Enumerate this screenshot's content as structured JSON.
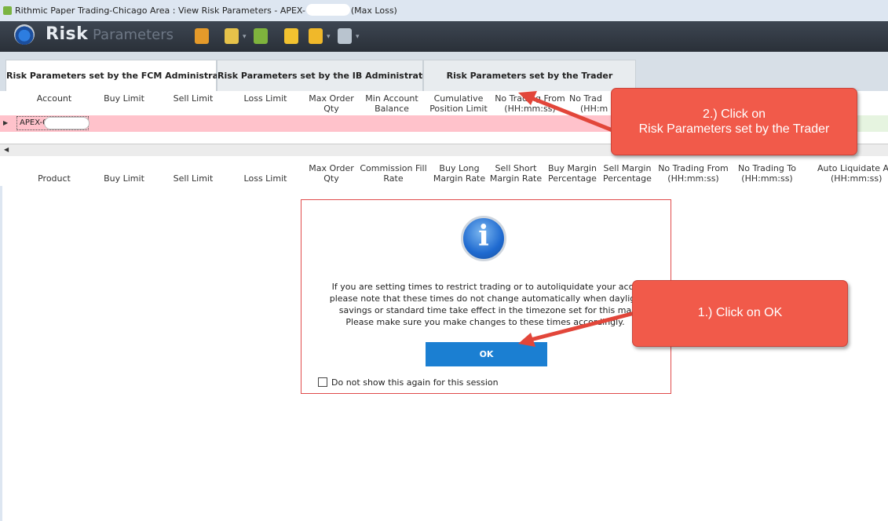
{
  "window": {
    "title_prefix": "Rithmic Paper Trading-Chicago Area : View Risk Parameters - APEX-",
    "title_suffix": "(Max Loss)"
  },
  "toolbar": {
    "logo_bold": "Risk",
    "logo_light": "Parameters"
  },
  "tabs": [
    {
      "label": "Risk Parameters set by the FCM Administrator",
      "active": true
    },
    {
      "label": "Risk Parameters set by the IB Administrator",
      "active": false
    },
    {
      "label": "Risk Parameters set by the Trader",
      "active": false
    }
  ],
  "account_grid": {
    "headers": [
      [
        "",
        "Account"
      ],
      [
        "",
        "Buy Limit"
      ],
      [
        "",
        "Sell Limit"
      ],
      [
        "",
        "Loss Limit"
      ],
      [
        "Max Order",
        "Qty"
      ],
      [
        "Min Account",
        "Balance"
      ],
      [
        "Cumulative",
        "Position Limit"
      ],
      [
        "No Trading From",
        "(HH:mm:ss)"
      ],
      [
        "No Trad",
        "(HH:m"
      ]
    ],
    "row_account": "APEX-00"
  },
  "product_grid": {
    "headers": [
      [
        "",
        "Product"
      ],
      [
        "",
        "Buy Limit"
      ],
      [
        "",
        "Sell Limit"
      ],
      [
        "",
        "Loss Limit"
      ],
      [
        "Max Order",
        "Qty"
      ],
      [
        "Commission Fill",
        "Rate"
      ],
      [
        "Buy Long",
        "Margin Rate"
      ],
      [
        "Sell Short",
        "Margin Rate"
      ],
      [
        "Buy Margin",
        "Percentage"
      ],
      [
        "Sell Margin",
        "Percentage"
      ],
      [
        "No Trading From",
        "(HH:mm:ss)"
      ],
      [
        "No Trading To",
        "(HH:mm:ss)"
      ],
      [
        "Auto Liquidate At",
        "(HH:mm:ss)"
      ]
    ]
  },
  "dialog": {
    "lines": [
      "If you are setting times to restrict trading or to autoliquidate your acco",
      "please note that these times do not change automatically when dayligh",
      "savings or standard time take effect in the timezone set for this ma",
      "Please make sure you make changes to these times accordingly."
    ],
    "ok_label": "OK",
    "checkbox_label": "Do not show this again for this session"
  },
  "callouts": {
    "tab_line1": "2.) Click on",
    "tab_line2": "Risk Parameters set by the Trader",
    "ok": "1.) Click on OK"
  },
  "colors": {
    "callout": "#f15a4a",
    "ok_button": "#1b7fd2",
    "selected_row": "#ffc2cb",
    "dialog_border": "#e04b4b"
  }
}
